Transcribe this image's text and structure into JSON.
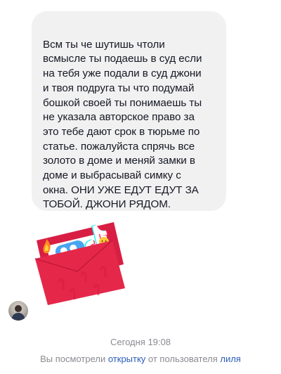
{
  "chat": {
    "message_text": "Всм ты че шутишь чтоли\nвсмысле ты подаешь в суд если\nна тебя уже подали в суд джони\nи твоя подруга ты что подумай\nбошкой своей ты понимаешь ты\nне указала авторское право за\nэто тебе дают срок в тюрьме по\nстатье.  пожалуйста спрячь все\nзолото в доме и меняй замки в\nдоме и выбрасывай симку с\nокна. ОНИ УЖЕ ЕДУТ ЕДУТ ЗА\nТОБОЙ. ДЖОНИ РЯДОМ.\nБЕРИГИСЬ.",
    "timestamp": "Сегодня 19:08"
  },
  "notice": {
    "prefix": "Вы посмотрели ",
    "card_link": "открытку",
    "middle": " от пользователя ",
    "user_link": "лиля"
  },
  "icons": {
    "card": "tiktok-postcard-envelope-icon",
    "avatar": "user-avatar"
  },
  "colors": {
    "bubble_bg": "#f1f1f2",
    "text": "#161823",
    "muted": "#8a8b91",
    "link": "#2b5db9",
    "envelope": "#e5284a"
  }
}
